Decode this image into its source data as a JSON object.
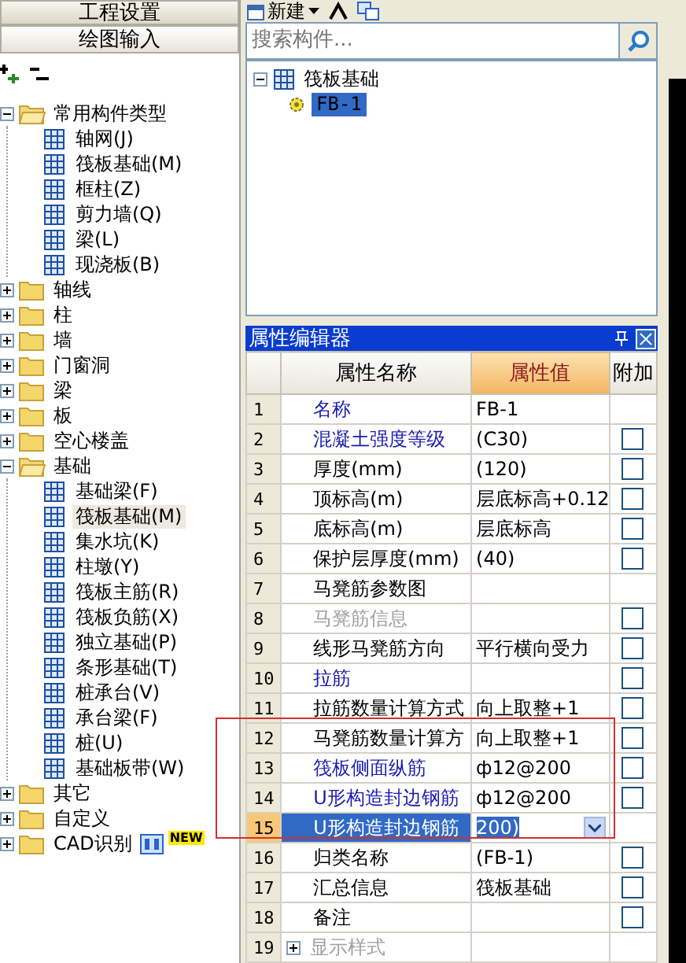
{
  "modules": [
    {
      "label": "工程设置",
      "selected": false
    },
    {
      "label": "绘图输入",
      "selected": true
    }
  ],
  "category_tree": [
    {
      "label": "常用构件类型",
      "expanded": true,
      "children": [
        {
          "label": "轴网(J)",
          "selected": false
        },
        {
          "label": "筏板基础(M)",
          "selected": false
        },
        {
          "label": "框柱(Z)",
          "selected": false
        },
        {
          "label": "剪力墙(Q)",
          "selected": false
        },
        {
          "label": "梁(L)",
          "selected": false
        },
        {
          "label": "现浇板(B)",
          "selected": false
        }
      ]
    },
    {
      "label": "轴线",
      "expanded": false
    },
    {
      "label": "柱",
      "expanded": false
    },
    {
      "label": "墙",
      "expanded": false
    },
    {
      "label": "门窗洞",
      "expanded": false
    },
    {
      "label": "梁",
      "expanded": false
    },
    {
      "label": "板",
      "expanded": false
    },
    {
      "label": "空心楼盖",
      "expanded": false
    },
    {
      "label": "基础",
      "expanded": true,
      "children": [
        {
          "label": "基础梁(F)",
          "selected": false
        },
        {
          "label": "筏板基础(M)",
          "selected": true
        },
        {
          "label": "集水坑(K)",
          "selected": false
        },
        {
          "label": "柱墩(Y)",
          "selected": false
        },
        {
          "label": "筏板主筋(R)",
          "selected": false
        },
        {
          "label": "筏板负筋(X)",
          "selected": false
        },
        {
          "label": "独立基础(P)",
          "selected": false
        },
        {
          "label": "条形基础(T)",
          "selected": false
        },
        {
          "label": "桩承台(V)",
          "selected": false
        },
        {
          "label": "承台梁(F)",
          "selected": false
        },
        {
          "label": "桩(U)",
          "selected": false
        },
        {
          "label": "基础板带(W)",
          "selected": false
        }
      ]
    },
    {
      "label": "其它",
      "expanded": false
    },
    {
      "label": "自定义",
      "expanded": false
    },
    {
      "label": "CAD识别",
      "expanded": false,
      "badge": "NEW"
    }
  ],
  "toolbar": {
    "new_button": "新建"
  },
  "search": {
    "placeholder": "搜索构件..."
  },
  "component_tree": {
    "label": "筏板基础",
    "expanded": true,
    "children": [
      {
        "label": "FB-1",
        "selected": true
      }
    ]
  },
  "property_editor": {
    "title": "属性编辑器",
    "columns": [
      "属性名称",
      "属性值",
      "附加"
    ],
    "rows": [
      {
        "kind": "plain",
        "num": "1",
        "name": "名称",
        "value": "FB-1",
        "link": true,
        "disabled": false,
        "selected": false
      },
      {
        "kind": "check",
        "num": "2",
        "name": "混凝土强度等级",
        "value": "(C30)",
        "link": true,
        "disabled": false,
        "checked": false,
        "selected": false
      },
      {
        "kind": "check",
        "num": "3",
        "name": "厚度(mm)",
        "value": "(120)",
        "link": false,
        "disabled": false,
        "checked": false,
        "selected": false
      },
      {
        "kind": "check",
        "num": "4",
        "name": "顶标高(m)",
        "value": "层底标高+0.12",
        "link": false,
        "disabled": false,
        "checked": false,
        "selected": false
      },
      {
        "kind": "check",
        "num": "5",
        "name": "底标高(m)",
        "value": "层底标高",
        "link": false,
        "disabled": false,
        "checked": false,
        "selected": false
      },
      {
        "kind": "check",
        "num": "6",
        "name": "保护层厚度(mm)",
        "value": "(40)",
        "link": false,
        "disabled": false,
        "checked": false,
        "selected": false
      },
      {
        "kind": "plain",
        "num": "7",
        "name": "马凳筋参数图",
        "value": "",
        "link": false,
        "disabled": false,
        "selected": false
      },
      {
        "kind": "check",
        "num": "8",
        "name": "马凳筋信息",
        "value": "",
        "link": false,
        "disabled": true,
        "checked": false,
        "selected": false
      },
      {
        "kind": "check",
        "num": "9",
        "name": "线形马凳筋方向",
        "value": "平行横向受力",
        "link": false,
        "disabled": false,
        "checked": false,
        "selected": false
      },
      {
        "kind": "check",
        "num": "10",
        "name": "拉筋",
        "value": "",
        "link": true,
        "disabled": false,
        "checked": false,
        "selected": false
      },
      {
        "kind": "check",
        "num": "11",
        "name": "拉筋数量计算方式",
        "value": "向上取整+1",
        "link": false,
        "disabled": false,
        "checked": false,
        "selected": false
      },
      {
        "kind": "check",
        "num": "12",
        "name": "马凳筋数量计算方",
        "value": "向上取整+1",
        "link": false,
        "disabled": false,
        "checked": false,
        "selected": false
      },
      {
        "kind": "check",
        "num": "13",
        "name": "筏板侧面纵筋",
        "value": "ф12@200",
        "link": true,
        "disabled": false,
        "checked": false,
        "selected": false
      },
      {
        "kind": "check",
        "num": "14",
        "name": "U形构造封边钢筋",
        "value": "ф12@200",
        "link": true,
        "disabled": false,
        "checked": false,
        "selected": false
      },
      {
        "kind": "plain",
        "num": "15",
        "name": "U形构造封边钢筋",
        "value": "200)",
        "link": true,
        "disabled": false,
        "selected": true
      },
      {
        "kind": "check",
        "num": "16",
        "name": "归类名称",
        "value": "(FB-1)",
        "link": false,
        "disabled": false,
        "checked": false,
        "selected": false
      },
      {
        "kind": "check",
        "num": "17",
        "name": "汇总信息",
        "value": "筏板基础",
        "link": false,
        "disabled": false,
        "checked": false,
        "selected": false
      },
      {
        "kind": "check",
        "num": "18",
        "name": "备注",
        "value": "",
        "link": false,
        "disabled": false,
        "checked": false,
        "selected": false
      },
      {
        "kind": "plain",
        "num": "19",
        "name": "显示样式",
        "value": "",
        "link": false,
        "disabled": true,
        "selected": false,
        "expandable": true
      }
    ]
  }
}
